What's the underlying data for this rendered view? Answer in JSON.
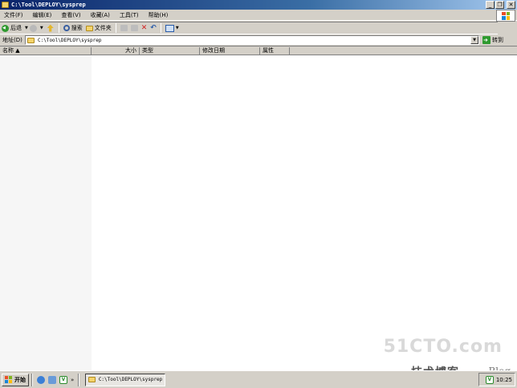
{
  "window": {
    "title": "C:\\Tool\\DEPLOY\\sysprep",
    "minimize_label": "_",
    "maximize_label": "❐",
    "close_label": "✕"
  },
  "menubar": {
    "items": [
      "文件(F)",
      "编辑(E)",
      "查看(V)",
      "收藏(A)",
      "工具(T)",
      "帮助(H)"
    ]
  },
  "toolbar": {
    "back_label": "后退",
    "search_label": "搜索",
    "folders_label": "文件夹"
  },
  "addressbar": {
    "label": "地址(D)",
    "value": "C:\\Tool\\DEPLOY\\sysprep",
    "go_label": "转到"
  },
  "filelist": {
    "columns": [
      "名称 ▲",
      "大小",
      "类型",
      "修改日期",
      "属性"
    ]
  },
  "taskbar": {
    "start_label": "开始",
    "quicklaunch_more": "»",
    "vm_label": "V",
    "task_button_label": "C:\\Tool\\DEPLOY\\sysprep",
    "clock": "10:25"
  },
  "watermark": {
    "main": "51CTO.com",
    "sub": "技术博客",
    "blog": "Blog"
  },
  "colors": {
    "titlebar_start": "#0a246a",
    "titlebar_end": "#a6caf0",
    "face": "#d4d0c8",
    "list_background": "#ffffff"
  }
}
